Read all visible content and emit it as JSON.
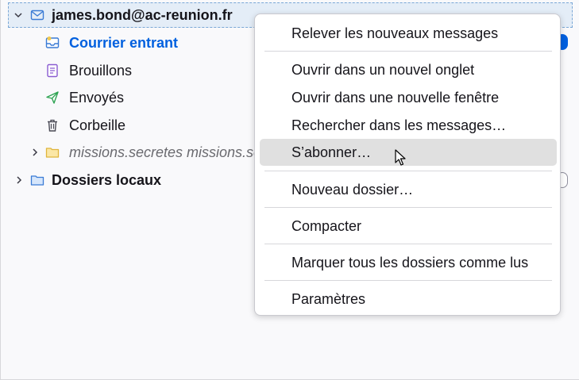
{
  "folder_pane": {
    "account": {
      "label": "james.bond@ac-reunion.fr",
      "expanded": true
    },
    "folders": [
      {
        "label": "Courrier entrant",
        "icon": "inbox-icon"
      },
      {
        "label": "Brouillons",
        "icon": "drafts-icon"
      },
      {
        "label": "Envoyés",
        "icon": "sent-icon"
      },
      {
        "label": "Corbeille",
        "icon": "trash-icon"
      },
      {
        "label": "missions.secretes missions.sec",
        "icon": "folder-icon"
      }
    ],
    "local_folders": {
      "label": "Dossiers locaux"
    }
  },
  "context_menu": {
    "items": [
      {
        "label": "Relever les nouveaux messages"
      },
      {
        "label": "Ouvrir dans un nouvel onglet"
      },
      {
        "label": "Ouvrir dans une nouvelle fenêtre"
      },
      {
        "label": "Rechercher dans les messages…"
      },
      {
        "label": "S’abonner…",
        "highlighted": true
      },
      {
        "label": "Nouveau dossier…"
      },
      {
        "label": "Compacter"
      },
      {
        "label": "Marquer tous les dossiers comme lus"
      },
      {
        "label": "Paramètres"
      }
    ]
  },
  "colors": {
    "accent": "#0060df",
    "selection_bg": "#e4edf7",
    "menu_hover": "#e0e0e0",
    "folder_yellow": "#f2c94c",
    "drafts_purple": "#8a5cd1",
    "sent_green": "#2ea352"
  }
}
